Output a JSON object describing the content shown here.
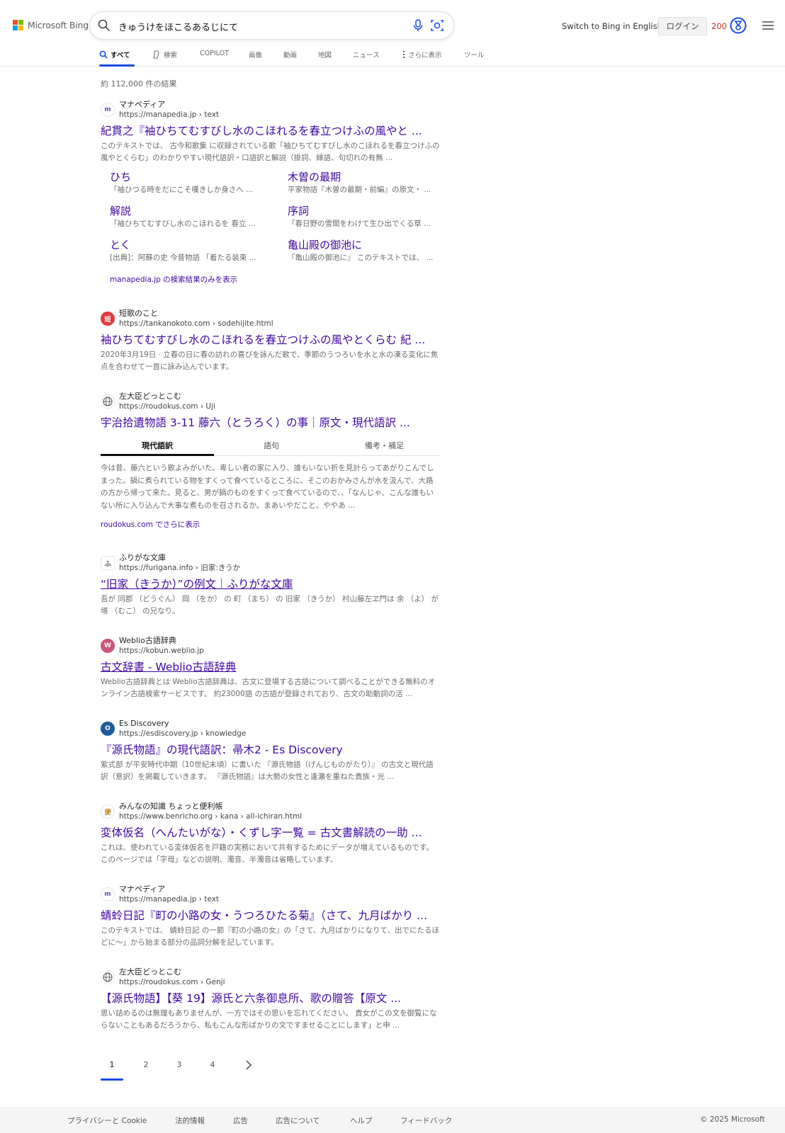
{
  "header": {
    "logo_text": "Microsoft Bing",
    "search_query": "きゅうけをほこるあるじにて",
    "switch_language": "Switch to Bing in English",
    "login": "ログイン",
    "points": "200"
  },
  "tabs": [
    {
      "label": "すべて",
      "icon": "search-icon"
    },
    {
      "label": "検索",
      "icon": "copilot-icon"
    },
    {
      "label": "COPILOT"
    },
    {
      "label": "画像"
    },
    {
      "label": "動画"
    },
    {
      "label": "地図"
    },
    {
      "label": "ニュース"
    },
    {
      "label": "さらに表示",
      "icon": "more-vertical-icon"
    },
    {
      "label": "ツール"
    }
  ],
  "result_count": "約 112,000 件の結果",
  "results": [
    {
      "site_name": "マナペディア",
      "url": "https://manapedia.jp › text",
      "title": "紀貫之『袖ひちてむすびし水のこほれるを春立つけふの風やと ...",
      "snippet": "このテキストでは、 古今和歌集 に収録されている歌「袖ひちてむすびし水のこほれるを春立つけふの風やとくらむ」のわかりやすい現代語訳・口語訳と解説（掛詞、縁語、句切れの有無 ...",
      "favicon": "m"
    },
    {
      "site_name": "短歌のこと",
      "url": "https://tankanokoto.com › sodehijite.html",
      "title": "袖ひちてむすびし水のこほれるを春立つけふの風やとくらむ 紀 ...",
      "snippet": "2020年3月19日 · 立春の日に春の訪れの喜びを詠んだ歌で、季節のうつろいを水と水の凍る変化に焦点を合わせて一首に詠み込んでいます。",
      "favicon": "短"
    },
    {
      "site_name": "左大臣どっとこむ",
      "url": "https://roudokus.com › Uji",
      "title": "宇治拾遺物語 3-11 藤六（とうろく）の事｜原文・現代語訳 ...",
      "snippet": "",
      "favicon": "globe"
    },
    {
      "site_name": "ふりがな文庫",
      "url": "https://furigana.info › 旧家:きうか",
      "title": "“旧家（きうか）”の例文｜ふりがな文庫",
      "snippet": "吾が 同郡 （どうぐん） 岡 （をか） の 町 （まち） の 旧家 （きうか） 村山藤左ヱ門は 余 （よ） が 壻 （むこ） の兄なり。",
      "favicon": "ふ"
    },
    {
      "site_name": "Weblio古語辞典",
      "url": "https://kobun.weblio.jp",
      "title": "古文辞書 - Weblio古語辞典",
      "snippet": "Weblio古語辞典とは Weblio古語辞典は、古文に登場する古語について調べることができる無料のオンライン古語検索サービスです。 約23000語 の古語が登録されており、古文の助動詞の活 ...",
      "favicon": "W"
    },
    {
      "site_name": "Es Discovery",
      "url": "https://esdiscovery.jp › knowledge",
      "title": "『源氏物語』の現代語訳：帚木2 - Es Discovery",
      "snippet": "紫式部 が平安時代中期（10世紀末頃）に書いた 『源氏物語（げんじものがたり）』 の古文と現代語訳（意訳）を掲載していきます。 『源氏物語』は大勢の女性と逢瀬を重ねた貴族・光 ...",
      "favicon": "O"
    },
    {
      "site_name": "みんなの知識 ちょっと便利帳",
      "url": "https://www.benricho.org › kana › all-ichiran.html",
      "title": "変体仮名（へんたいがな）・くずし字一覧 = 古文書解読の一助 ...",
      "snippet": "これは、使われている変体仮名を戸籍の実務において共有するためにデータが増えているものです。 このページでは「字母」などの説明、濁音、半濁音は省略しています。",
      "favicon": "便"
    },
    {
      "site_name": "マナペディア",
      "url": "https://manapedia.jp › text",
      "title": "蜻蛉日記『町の小路の女・うつろひたる菊』（さて、九月ばかり ...",
      "snippet": "このテキストでは、 蜻蛉日記 の一節『町の小路の女』の「さて、九月ばかりになりて、出でにたるほどに〜」から始まる部分の品詞分解を記しています。",
      "favicon": "m"
    },
    {
      "site_name": "左大臣どっとこむ",
      "url": "https://roudokus.com › Genji",
      "title": "【源氏物語】【葵 19】源氏と六条御息所、歌の贈答【原文 ...",
      "snippet": "思い詰めるのは無理もありませんが、一方ではその思いを忘れてください。 貴女がこの文を御覧にならないこともあるだろうから、私もこんな形ばかりの文ですませることにします」と申 ...",
      "favicon": "globe"
    }
  ],
  "deeplinks": [
    {
      "title": "ひち",
      "snippet": "「袖ひつる時をだにこそ嘆きしか身さへ ..."
    },
    {
      "title": "木曽の最期",
      "snippet": "平家物語『木曽の最期・前編』の原文・ ..."
    },
    {
      "title": "解説",
      "snippet": "「袖ひちてむすびし水のこほれるを 春立 ..."
    },
    {
      "title": "序詞",
      "snippet": "「春日野の雪間をわけて生ひ出でくる草 ..."
    },
    {
      "title": "とく",
      "snippet": "[出典]：阿蘇の史 今昔物語 「着たる装束 ..."
    },
    {
      "title": "亀山殿の御池に",
      "snippet": "『亀山殿の御池に』 このテキストでは、 ..."
    }
  ],
  "site_only_link": "manapedia.jp の検索結果のみを表示",
  "inner_tabs": [
    "現代語訳",
    "語句",
    "備考・補足"
  ],
  "inner_text": "今は昔、藤六という歌よみがいた。卑しい者の家に入り、誰もいない折を見計らってあがりこんでしまった。鍋に煮られている物をすくって食べているところに、そこのおかみさんが水を汲んで、大路の方から帰って来た。見ると、男が鍋のものをすくって食べているので、、「なんじゃ、こんな誰もいない所に入り込んで大事な煮ものを召されるか。まあいやだこと。ややあ ...",
  "more_link": "roudokus.com でさらに表示",
  "pagination": [
    "1",
    "2",
    "3",
    "4"
  ],
  "footer": {
    "links": [
      "プライバシーと Cookie",
      "法的情報",
      "広告",
      "広告について",
      "ヘルプ",
      "フィードバック"
    ],
    "copyright": "© 2025 Microsoft"
  },
  "colors": {
    "link": "#4007a2",
    "accent": "#174ae4",
    "points": "#c4302b"
  }
}
